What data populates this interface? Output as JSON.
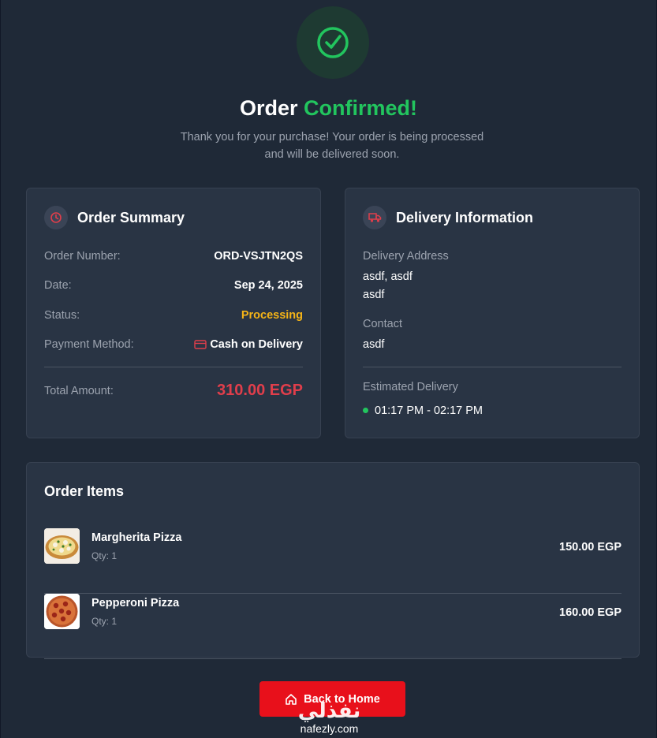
{
  "header": {
    "title_prefix": "Order",
    "title_accent": "Confirmed!",
    "subtitle_line1": "Thank you for your purchase! Your order is being processed",
    "subtitle_line2": "and will be delivered soon.",
    "icon": "check-circle-icon"
  },
  "summary": {
    "title": "Order Summary",
    "icon": "clock-icon",
    "order_number_label": "Order Number:",
    "order_number": "ORD-VSJTN2QS",
    "date_label": "Date:",
    "date": "Sep 24, 2025",
    "status_label": "Status:",
    "status": "Processing",
    "payment_label": "Payment Method:",
    "payment": "Cash on Delivery",
    "payment_icon": "credit-card-icon",
    "total_label": "Total Amount:",
    "total": "310.00 EGP"
  },
  "delivery": {
    "title": "Delivery Information",
    "icon": "truck-icon",
    "address_label": "Delivery Address",
    "address_line1": "asdf, asdf",
    "address_line2": "asdf",
    "contact_label": "Contact",
    "contact": "asdf",
    "estimate_label": "Estimated Delivery",
    "estimate": "01:17 PM - 02:17 PM"
  },
  "items": {
    "title": "Order Items",
    "list": [
      {
        "name": "Margherita Pizza",
        "qty": "Qty: 1",
        "price": "150.00 EGP"
      },
      {
        "name": "Pepperoni Pizza",
        "qty": "Qty: 1",
        "price": "160.00 EGP"
      }
    ]
  },
  "actions": {
    "back_home": "Back to Home",
    "home_icon": "home-icon"
  },
  "watermark": {
    "arabic": "نفذلي",
    "latin": "nafezly.com"
  },
  "colors": {
    "background": "#1f2937",
    "card": "#293444",
    "accent_green": "#22c55e",
    "status_orange": "#f5b417",
    "total_red": "#e03e4b",
    "button_red": "#e8101b"
  }
}
